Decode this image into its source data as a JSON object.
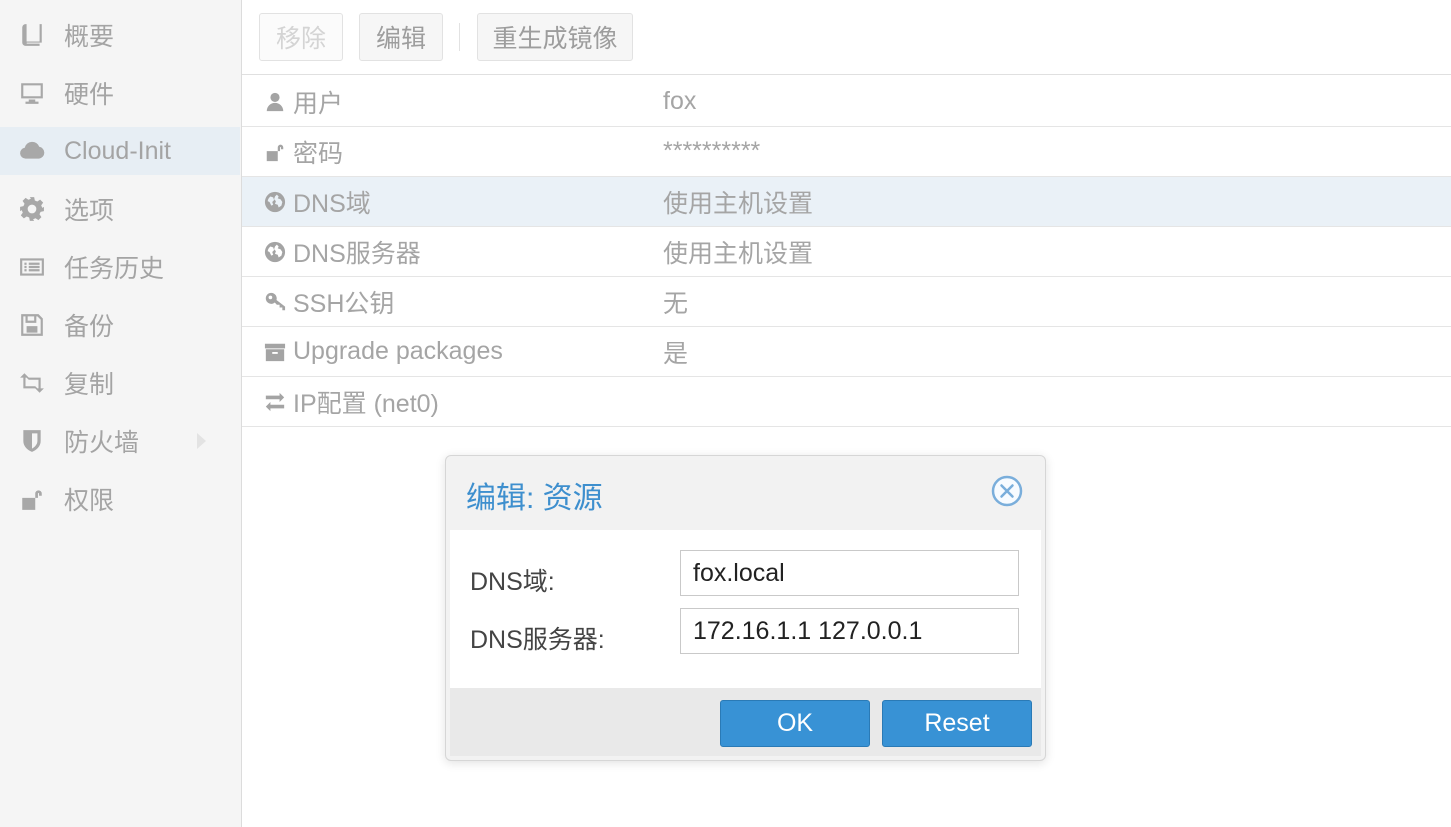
{
  "sidebar": {
    "items": [
      {
        "label": "概要",
        "icon": "book-icon"
      },
      {
        "label": "硬件",
        "icon": "monitor-icon"
      },
      {
        "label": "Cloud-Init",
        "icon": "cloud-icon",
        "active": true
      },
      {
        "label": "选项",
        "icon": "gear-icon"
      },
      {
        "label": "任务历史",
        "icon": "list-icon"
      },
      {
        "label": "备份",
        "icon": "floppy-icon"
      },
      {
        "label": "复制",
        "icon": "retweet-icon"
      },
      {
        "label": "防火墙",
        "icon": "shield-icon"
      },
      {
        "label": "权限",
        "icon": "unlock-icon"
      }
    ]
  },
  "toolbar": {
    "remove_label": "移除",
    "edit_label": "编辑",
    "regenerate_label": "重生成镜像"
  },
  "rows": [
    {
      "key": "用户",
      "value": "fox",
      "icon": "user-icon"
    },
    {
      "key": "密码",
      "value": "**********",
      "icon": "unlock-icon"
    },
    {
      "key": "DNS域",
      "value": "使用主机设置",
      "icon": "globe-icon",
      "selected": true
    },
    {
      "key": "DNS服务器",
      "value": "使用主机设置",
      "icon": "globe-icon"
    },
    {
      "key": "SSH公钥",
      "value": "无",
      "icon": "key-icon"
    },
    {
      "key": "Upgrade packages",
      "value": "是",
      "icon": "archive-icon"
    },
    {
      "key": "IP配置 (net0)",
      "value": "",
      "icon": "exchange-icon"
    }
  ],
  "dialog": {
    "title": "编辑: 资源",
    "fields": {
      "dns_domain_label": "DNS域:",
      "dns_domain_value": "fox.local",
      "dns_servers_label": "DNS服务器:",
      "dns_servers_value": "172.16.1.1 127.0.0.1"
    },
    "ok_label": "OK",
    "reset_label": "Reset"
  },
  "colors": {
    "accent": "#3892d5",
    "title": "#3e8fce",
    "selected_row": "#eaf1f7",
    "sidebar_active": "#e7eef4"
  }
}
